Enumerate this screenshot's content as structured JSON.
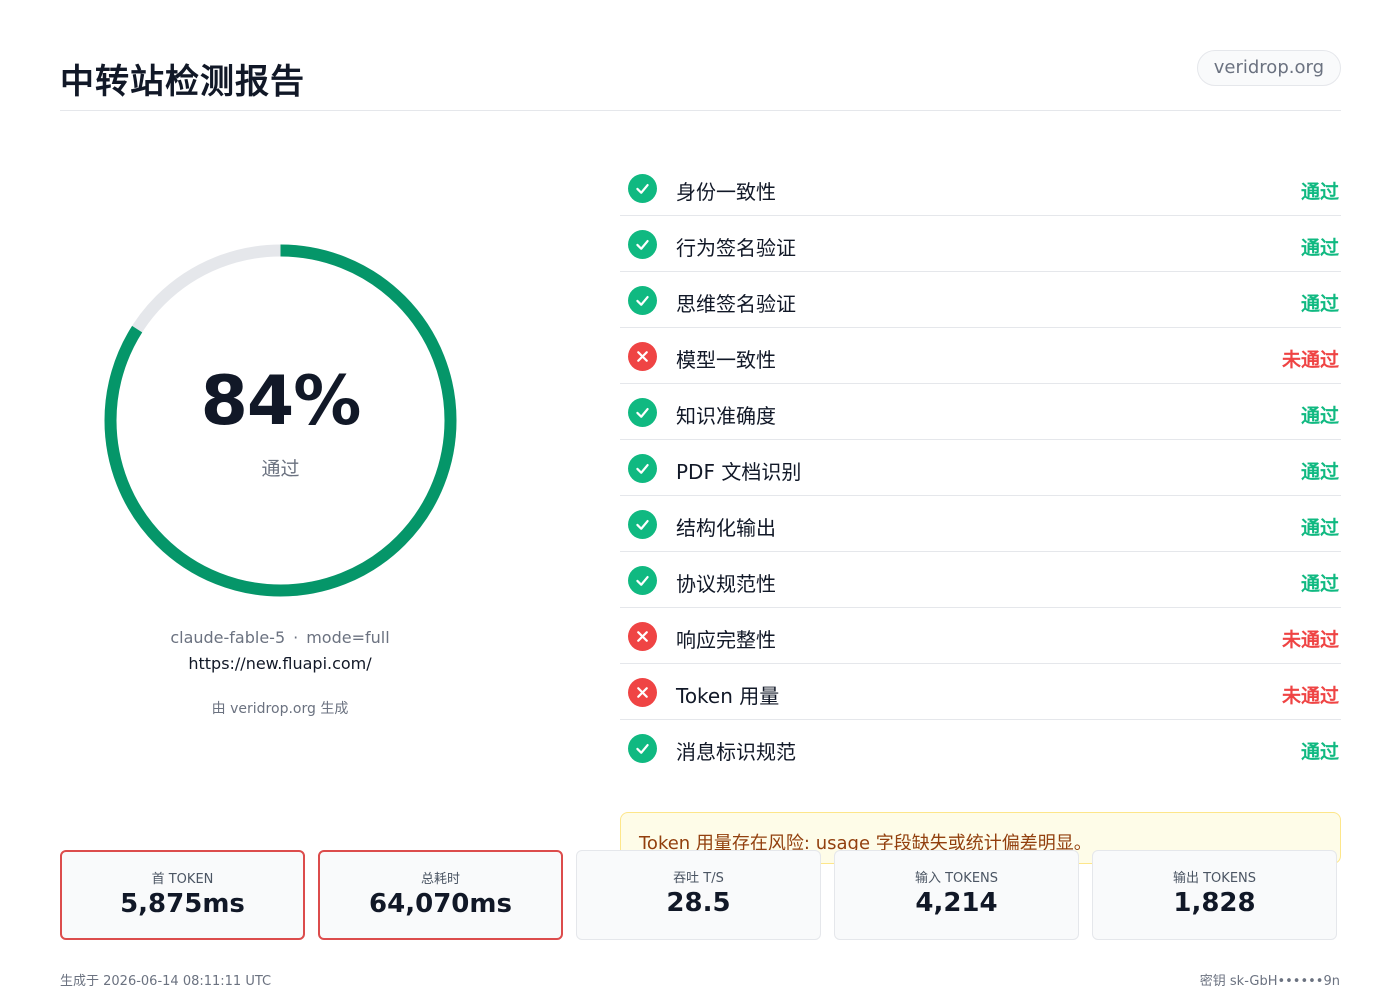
{
  "header": {
    "title": "中转站检测报告",
    "site_badge": "veridrop.org"
  },
  "score": {
    "percent": 84,
    "value_text": "84%",
    "label": "通过",
    "ring_color": "#059669"
  },
  "meta": {
    "model": "claude-fable-5",
    "separator": "·",
    "mode": "mode=full",
    "url": "https://new.fluapi.com/",
    "generated_by": "由 veridrop.org 生成"
  },
  "checks": [
    {
      "label": "身份一致性",
      "result": "通过",
      "status": "pass"
    },
    {
      "label": "行为签名验证",
      "result": "通过",
      "status": "pass"
    },
    {
      "label": "思维签名验证",
      "result": "通过",
      "status": "pass"
    },
    {
      "label": "模型一致性",
      "result": "未通过",
      "status": "fail"
    },
    {
      "label": "知识准确度",
      "result": "通过",
      "status": "pass"
    },
    {
      "label": "PDF 文档识别",
      "result": "通过",
      "status": "pass"
    },
    {
      "label": "结构化输出",
      "result": "通过",
      "status": "pass"
    },
    {
      "label": "协议规范性",
      "result": "通过",
      "status": "pass"
    },
    {
      "label": "响应完整性",
      "result": "未通过",
      "status": "fail"
    },
    {
      "label": "Token 用量",
      "result": "未通过",
      "status": "fail"
    },
    {
      "label": "消息标识规范",
      "result": "通过",
      "status": "pass"
    }
  ],
  "warning": {
    "text": "Token 用量存在风险: usage 字段缺失或统计偏差明显。"
  },
  "metrics": [
    {
      "label": "首 TOKEN",
      "value": "5,875ms",
      "alert": true
    },
    {
      "label": "总耗时",
      "value": "64,070ms",
      "alert": true
    },
    {
      "label": "吞吐 T/S",
      "value": "28.5",
      "alert": false
    },
    {
      "label": "输入 TOKENS",
      "value": "4,214",
      "alert": false
    },
    {
      "label": "输出 TOKENS",
      "value": "1,828",
      "alert": false
    }
  ],
  "footer": {
    "generated_at": "生成于 2026-06-14 08:11:11 UTC",
    "key": "密钥 sk-GbH••••••9n"
  },
  "colors": {
    "pass": "#10b981",
    "fail": "#ef4444",
    "alert_border": "#dc4c4c"
  }
}
